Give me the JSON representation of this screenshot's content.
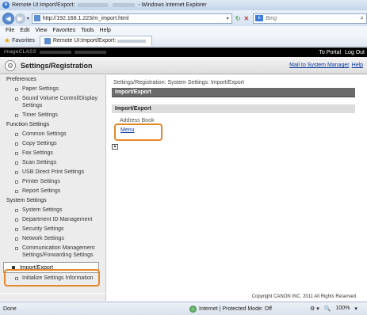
{
  "window": {
    "title_prefix": "Remote UI:Import/Export:",
    "title_suffix": "- Windows Internet Explorer"
  },
  "address_bar": {
    "url": "http://192.168.1.223/m_import.html",
    "search_placeholder": "Bing"
  },
  "menu": [
    "File",
    "Edit",
    "View",
    "Favorites",
    "Tools",
    "Help"
  ],
  "favorites": {
    "label": "Favorites",
    "tab_title": "Remote UI:Import/Export:"
  },
  "product_header": {
    "name": "imageCLASS",
    "links": [
      "To Portal",
      "Log Out"
    ]
  },
  "page_header": {
    "title": "Settings/Registration",
    "links": [
      "Mail to System Manager",
      "Help"
    ]
  },
  "sidebar": {
    "groups": [
      {
        "title": "Preferences",
        "items": [
          "Paper Settings",
          "Sound Volume Control/Display Settings",
          "Timer Settings"
        ]
      },
      {
        "title": "Function Settings",
        "items": [
          "Common Settings",
          "Copy Settings",
          "Fax Settings",
          "Scan Settings",
          "USB Direct Print Settings",
          "Printer Settings",
          "Report Settings"
        ]
      },
      {
        "title": "System Settings",
        "items": [
          "System Settings",
          "Department ID Management",
          "Security Settings",
          "Network Settings",
          "Communication Management Settings/Forwarding Settings",
          "Import/Export",
          "Initialize Settings Information"
        ]
      }
    ]
  },
  "main": {
    "breadcrumb": "Settings/Registration: System Settings: Import/Export",
    "section_title": "Import/Export",
    "sub_title": "Import/Export",
    "plain_link": "Address Book",
    "menu_link": "Menu",
    "top_icon_glyph": "▲"
  },
  "footer": {
    "copyright": "Copyright CANON INC. 2011 All Rights Reserved"
  },
  "statusbar": {
    "left": "Done",
    "zone": "Internet | Protected Mode: Off",
    "zoom": "100%"
  },
  "colors": {
    "highlight": "#e4862a",
    "section_bar": "#6a6a6a",
    "link": "#0a3aa3"
  }
}
